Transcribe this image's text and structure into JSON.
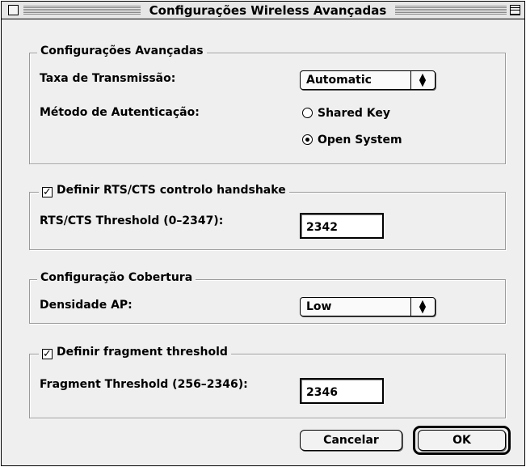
{
  "window": {
    "title": "Configurações Wireless Avançadas"
  },
  "advanced": {
    "group_title": "Configurações Avançadas",
    "rate_label": "Taxa de Transmissão:",
    "rate_value": "Automatic",
    "auth_label": "Método de Autenticação:",
    "auth_options": [
      {
        "label": "Shared Key",
        "selected": false
      },
      {
        "label": "Open System",
        "selected": true
      }
    ]
  },
  "rts": {
    "checkbox_label": "Definir RTS/CTS controlo handshake",
    "checked": true,
    "threshold_label": "RTS/CTS Threshold (0–2347):",
    "threshold_value": "2342"
  },
  "coverage": {
    "group_title": "Configuração Cobertura",
    "density_label": "Densidade AP:",
    "density_value": "Low"
  },
  "fragment": {
    "checkbox_label": "Definir fragment threshold",
    "checked": true,
    "threshold_label": "Fragment Threshold (256–2346):",
    "threshold_value": "2346"
  },
  "buttons": {
    "cancel": "Cancelar",
    "ok": "OK"
  },
  "icons": {
    "popup_arrows": "up-down-arrows-icon",
    "checkbox_check": "checkmark-icon"
  }
}
